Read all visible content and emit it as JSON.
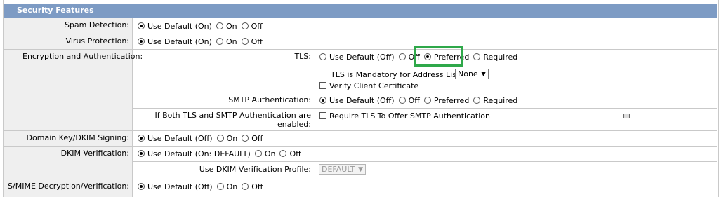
{
  "section_title": "Security Features",
  "spam": {
    "label": "Spam Detection:",
    "options": [
      "Use Default (On)",
      "On",
      "Off"
    ]
  },
  "virus": {
    "label": "Virus Protection:",
    "options": [
      "Use Default (On)",
      "On",
      "Off"
    ]
  },
  "encryption": {
    "label": "Encryption and Authentication:",
    "tls": {
      "label": "TLS:",
      "options": [
        "Use Default (Off)",
        "Off",
        "Preferred",
        "Required"
      ],
      "selected": "Preferred",
      "mandatory_label": "TLS is Mandatory for Address List:",
      "mandatory_value": "None",
      "verify_label": "Verify Client Certificate"
    },
    "smtp": {
      "label": "SMTP Authentication:",
      "options": [
        "Use Default (Off)",
        "Off",
        "Preferred",
        "Required"
      ]
    },
    "both": {
      "label_line1": "If Both TLS and SMTP Authentication are",
      "label_line2": "enabled:",
      "checkbox_label": "Require TLS To Offer SMTP Authentication"
    }
  },
  "dkim_sign": {
    "label": "Domain Key/DKIM Signing:",
    "options": [
      "Use Default (Off)",
      "On",
      "Off"
    ]
  },
  "dkim_verify": {
    "label": "DKIM Verification:",
    "options": [
      "Use Default (On: DEFAULT)",
      "On",
      "Off"
    ],
    "profile_label": "Use DKIM Verification Profile:",
    "profile_value": "DEFAULT"
  },
  "smime": {
    "label": "S/MIME Decryption/Verification:",
    "options": [
      "Use Default (Off)",
      "On",
      "Off"
    ]
  },
  "colors": {
    "header_bg": "#7d9bc4",
    "label_bg": "#efefef",
    "highlight": "#2fa84a"
  },
  "icons": {
    "select_arrow": "chevron-down-icon",
    "table_icon": "table-icon"
  }
}
